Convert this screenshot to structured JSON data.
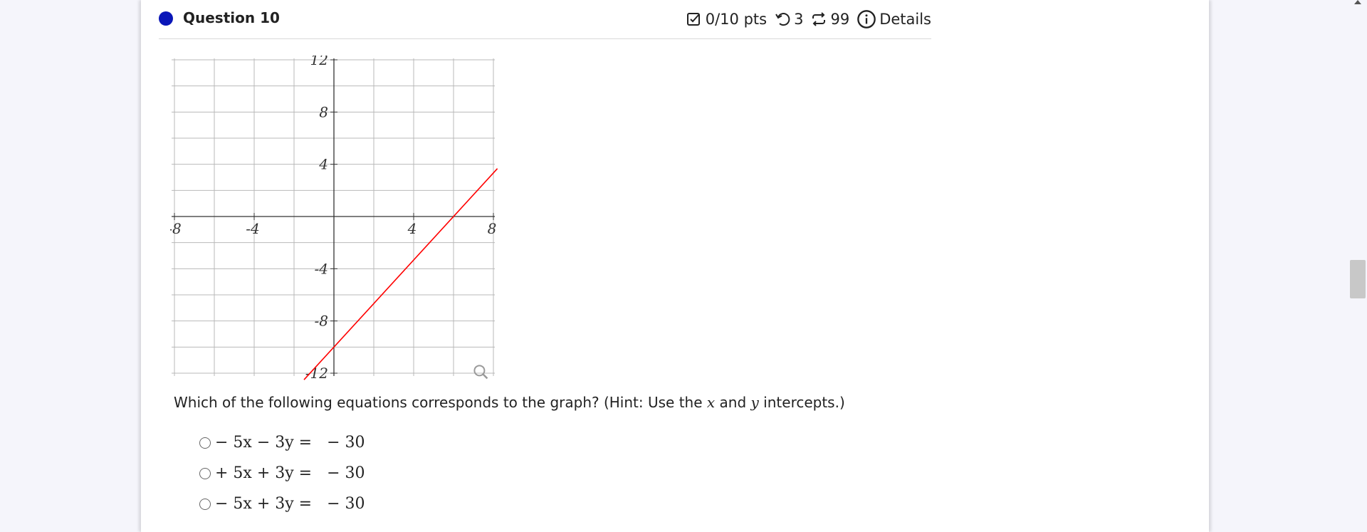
{
  "question": {
    "title": "Question 10",
    "score": "0/10 pts",
    "retries": "3",
    "attempts": "99",
    "details_label": "Details",
    "prompt_start": "Which of the following equations corresponds to the graph? (Hint: Use the ",
    "var_x": "x",
    "prompt_and": " and ",
    "var_y": "y",
    "prompt_end": " intercepts.)"
  },
  "options": [
    {
      "label": "− 5x − 3y =   − 30",
      "selected": false
    },
    {
      "label": "+ 5x + 3y =   − 30",
      "selected": false
    },
    {
      "label": "− 5x + 3y =   − 30",
      "selected": false
    }
  ],
  "icons": {
    "score": "checkbox-pencil-icon",
    "retries": "undo-icon",
    "attempts": "repeat-icon",
    "details": "info-circle-icon",
    "graph_zoom": "magnifier-icon"
  },
  "colors": {
    "question_dot": "#0a16b8",
    "line": "#ff0000"
  },
  "chart_data": {
    "type": "line",
    "title": "",
    "xlabel": "",
    "ylabel": "",
    "xlim": [
      -8,
      8
    ],
    "ylim": [
      -12,
      12
    ],
    "grid": true,
    "x_ticks": [
      "-8",
      "-4",
      "4",
      "8"
    ],
    "y_ticks": [
      "12",
      "8",
      "4",
      "-4",
      "-8",
      "-12"
    ],
    "series": [
      {
        "x": [
          -1.5,
          8.2
        ],
        "y": [
          -12.5,
          3.67
        ]
      }
    ]
  }
}
